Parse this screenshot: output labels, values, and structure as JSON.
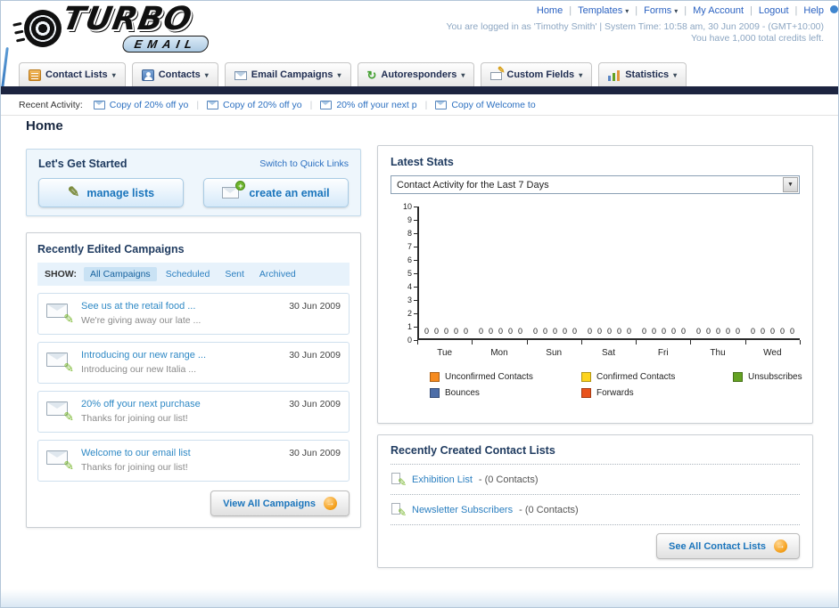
{
  "header": {
    "logo": {
      "line1": "TURBO",
      "line2": "EMAIL"
    },
    "nav": [
      {
        "label": "Home",
        "dropdown": false
      },
      {
        "label": "Templates",
        "dropdown": true
      },
      {
        "label": "Forms",
        "dropdown": true
      },
      {
        "label": "My Account",
        "dropdown": false
      },
      {
        "label": "Logout",
        "dropdown": false
      },
      {
        "label": "Help",
        "dropdown": false
      }
    ],
    "login_info": "You are logged in as 'Timothy Smith' | System Time: 10:58 am, 30 Jun 2009 - (GMT+10:00)",
    "credits_info": "You have 1,000 total credits left."
  },
  "main_nav": {
    "tabs": [
      {
        "label": "Contact Lists"
      },
      {
        "label": "Contacts"
      },
      {
        "label": "Email Campaigns"
      },
      {
        "label": "Autoresponders"
      },
      {
        "label": "Custom Fields"
      },
      {
        "label": "Statistics"
      }
    ]
  },
  "recent_activity": {
    "label": "Recent Activity:",
    "items": [
      {
        "label": "Copy of 20% off yo"
      },
      {
        "label": "Copy of 20% off yo"
      },
      {
        "label": "20% off your next p"
      },
      {
        "label": "Copy of Welcome to"
      }
    ]
  },
  "page": {
    "title": "Home"
  },
  "get_started": {
    "title": "Let's Get Started",
    "switch_link": "Switch to Quick Links",
    "manage_lists_label": "manage lists",
    "create_email_label": "create an email"
  },
  "campaigns": {
    "title": "Recently Edited Campaigns",
    "show_label": "SHOW:",
    "filters": [
      {
        "label": "All Campaigns",
        "active": true
      },
      {
        "label": "Scheduled",
        "active": false
      },
      {
        "label": "Sent",
        "active": false
      },
      {
        "label": "Archived",
        "active": false
      }
    ],
    "items": [
      {
        "title": "See us at the retail food ...",
        "subtitle": "We're giving away our late ...",
        "date": "30 Jun 2009"
      },
      {
        "title": "Introducing our new range ...",
        "subtitle": "Introducing our new Italia ...",
        "date": "30 Jun 2009"
      },
      {
        "title": "20% off your next purchase",
        "subtitle": "Thanks for joining our list!",
        "date": "30 Jun 2009"
      },
      {
        "title": "Welcome to our email list",
        "subtitle": "Thanks for joining our list!",
        "date": "30 Jun 2009"
      }
    ],
    "view_all_label": "View All Campaigns"
  },
  "stats": {
    "title": "Latest Stats",
    "activity_select_value": "Contact Activity for the Last 7 Days",
    "chart_data": {
      "type": "bar",
      "title": "Contact Activity for the Last 7 Days",
      "categories": [
        "Tue",
        "Mon",
        "Sun",
        "Sat",
        "Fri",
        "Thu",
        "Wed"
      ],
      "series": [
        {
          "name": "Unconfirmed Contacts",
          "color": "#f68b1f",
          "values": [
            0,
            0,
            0,
            0,
            0,
            0,
            0
          ]
        },
        {
          "name": "Confirmed Contacts",
          "color": "#fdd41e",
          "values": [
            0,
            0,
            0,
            0,
            0,
            0,
            0
          ]
        },
        {
          "name": "Unsubscribes",
          "color": "#64a223",
          "values": [
            0,
            0,
            0,
            0,
            0,
            0,
            0
          ]
        },
        {
          "name": "Bounces",
          "color": "#4d6ea8",
          "values": [
            0,
            0,
            0,
            0,
            0,
            0,
            0
          ]
        },
        {
          "name": "Forwards",
          "color": "#e9531d",
          "values": [
            0,
            0,
            0,
            0,
            0,
            0,
            0
          ]
        }
      ],
      "ylim": [
        0,
        10
      ],
      "yticks": [
        10,
        9,
        8,
        7,
        6,
        5,
        4,
        3,
        2,
        1,
        0
      ],
      "grid": false,
      "legend_position": "bottom"
    }
  },
  "contact_lists": {
    "title": "Recently Created Contact Lists",
    "items": [
      {
        "name": "Exhibition List",
        "count": "- (0 Contacts)"
      },
      {
        "name": "Newsletter Subscribers",
        "count": "- (0 Contacts)"
      }
    ],
    "see_all_label": "See All Contact Lists"
  }
}
